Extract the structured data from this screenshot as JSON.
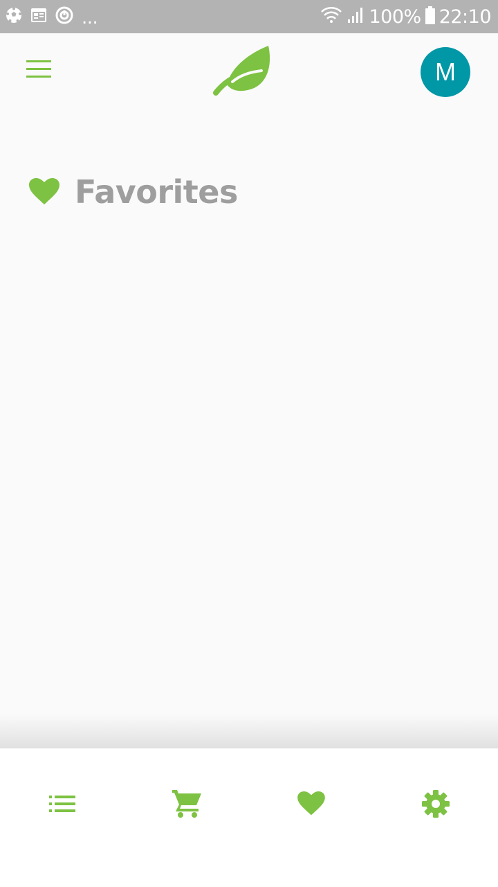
{
  "colors": {
    "accent": "#7dc242",
    "status_bar": "#b3b3b3",
    "avatar_bg": "#0097a7",
    "title_text": "#9e9e9e",
    "nav_bg": "#ffffff"
  },
  "status_bar": {
    "left_icons": [
      "soccer-ball-icon",
      "calendar-icon",
      "sync-icon"
    ],
    "overflow": "...",
    "right_icons": [
      "wifi-icon",
      "signal-icon",
      "battery-icon"
    ],
    "battery": "100%",
    "time": "22:10"
  },
  "app_bar": {
    "menu_icon": "hamburger-menu-icon",
    "logo_icon": "leaf-logo-icon",
    "avatar_initial": "M"
  },
  "page": {
    "title": "Favorites",
    "title_icon": "heart-icon"
  },
  "bottom_nav": {
    "items": [
      {
        "icon": "list-icon",
        "name": "nav-list"
      },
      {
        "icon": "cart-icon",
        "name": "nav-cart"
      },
      {
        "icon": "heart-icon",
        "name": "nav-favorites"
      },
      {
        "icon": "gear-icon",
        "name": "nav-settings"
      }
    ]
  }
}
